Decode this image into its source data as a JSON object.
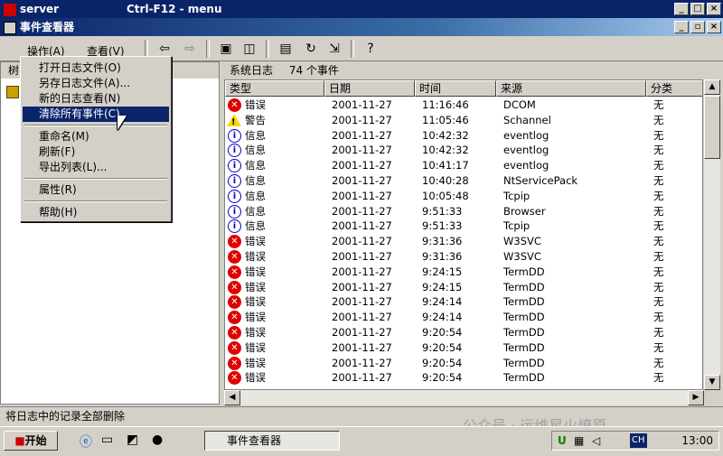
{
  "window": {
    "outer_title": "server",
    "outer_hint": "Ctrl-F12 - menu",
    "inner_title": "事件查看器"
  },
  "menubar": {
    "action": "操作(A)",
    "view": "查看(V)"
  },
  "toolbar_icons": [
    "back-arrow",
    "forward-arrow",
    "up-folder",
    "show-hide-tree",
    "properties",
    "refresh",
    "export",
    "help"
  ],
  "context_menu": [
    {
      "label": "打开日志文件(O)",
      "selected": false
    },
    {
      "label": "另存日志文件(A)...",
      "selected": false
    },
    {
      "label": "新的日志查看(N)",
      "selected": false
    },
    {
      "label": "清除所有事件(C)",
      "selected": true
    },
    {
      "label": "重命名(M)",
      "selected": false
    },
    {
      "label": "刷新(F)",
      "selected": false
    },
    {
      "label": "导出列表(L)...",
      "selected": false
    },
    {
      "label": "属性(R)",
      "selected": false
    },
    {
      "label": "帮助(H)",
      "selected": false
    }
  ],
  "left_header": "树",
  "list": {
    "title": "系统日志",
    "count": "74 个事件",
    "columns": [
      "类型",
      "日期",
      "时间",
      "来源",
      "分类"
    ],
    "rows": [
      {
        "type": "error",
        "type_label": "错误",
        "date": "2001-11-27",
        "time": "11:16:46",
        "source": "DCOM",
        "cat": "无"
      },
      {
        "type": "warn",
        "type_label": "警告",
        "date": "2001-11-27",
        "time": "11:05:46",
        "source": "Schannel",
        "cat": "无"
      },
      {
        "type": "info",
        "type_label": "信息",
        "date": "2001-11-27",
        "time": "10:42:32",
        "source": "eventlog",
        "cat": "无"
      },
      {
        "type": "info",
        "type_label": "信息",
        "date": "2001-11-27",
        "time": "10:42:32",
        "source": "eventlog",
        "cat": "无"
      },
      {
        "type": "info",
        "type_label": "信息",
        "date": "2001-11-27",
        "time": "10:41:17",
        "source": "eventlog",
        "cat": "无"
      },
      {
        "type": "info",
        "type_label": "信息",
        "date": "2001-11-27",
        "time": "10:40:28",
        "source": "NtServicePack",
        "cat": "无"
      },
      {
        "type": "info",
        "type_label": "信息",
        "date": "2001-11-27",
        "time": "10:05:48",
        "source": "Tcpip",
        "cat": "无"
      },
      {
        "type": "info",
        "type_label": "信息",
        "date": "2001-11-27",
        "time": "9:51:33",
        "source": "Browser",
        "cat": "无"
      },
      {
        "type": "info",
        "type_label": "信息",
        "date": "2001-11-27",
        "time": "9:51:33",
        "source": "Tcpip",
        "cat": "无"
      },
      {
        "type": "error",
        "type_label": "错误",
        "date": "2001-11-27",
        "time": "9:31:36",
        "source": "W3SVC",
        "cat": "无"
      },
      {
        "type": "error",
        "type_label": "错误",
        "date": "2001-11-27",
        "time": "9:31:36",
        "source": "W3SVC",
        "cat": "无"
      },
      {
        "type": "error",
        "type_label": "错误",
        "date": "2001-11-27",
        "time": "9:24:15",
        "source": "TermDD",
        "cat": "无"
      },
      {
        "type": "error",
        "type_label": "错误",
        "date": "2001-11-27",
        "time": "9:24:15",
        "source": "TermDD",
        "cat": "无"
      },
      {
        "type": "error",
        "type_label": "错误",
        "date": "2001-11-27",
        "time": "9:24:14",
        "source": "TermDD",
        "cat": "无"
      },
      {
        "type": "error",
        "type_label": "错误",
        "date": "2001-11-27",
        "time": "9:24:14",
        "source": "TermDD",
        "cat": "无"
      },
      {
        "type": "error",
        "type_label": "错误",
        "date": "2001-11-27",
        "time": "9:20:54",
        "source": "TermDD",
        "cat": "无"
      },
      {
        "type": "error",
        "type_label": "错误",
        "date": "2001-11-27",
        "time": "9:20:54",
        "source": "TermDD",
        "cat": "无"
      },
      {
        "type": "error",
        "type_label": "错误",
        "date": "2001-11-27",
        "time": "9:20:54",
        "source": "TermDD",
        "cat": "无"
      },
      {
        "type": "error",
        "type_label": "错误",
        "date": "2001-11-27",
        "time": "9:20:54",
        "source": "TermDD",
        "cat": "无"
      }
    ]
  },
  "status_text": "将日志中的记录全部删除",
  "taskbar": {
    "start": "开始",
    "task": "事件查看器",
    "lang": "CH",
    "clock": "13:00"
  },
  "watermark": "公众号 · 运维星火燎原"
}
